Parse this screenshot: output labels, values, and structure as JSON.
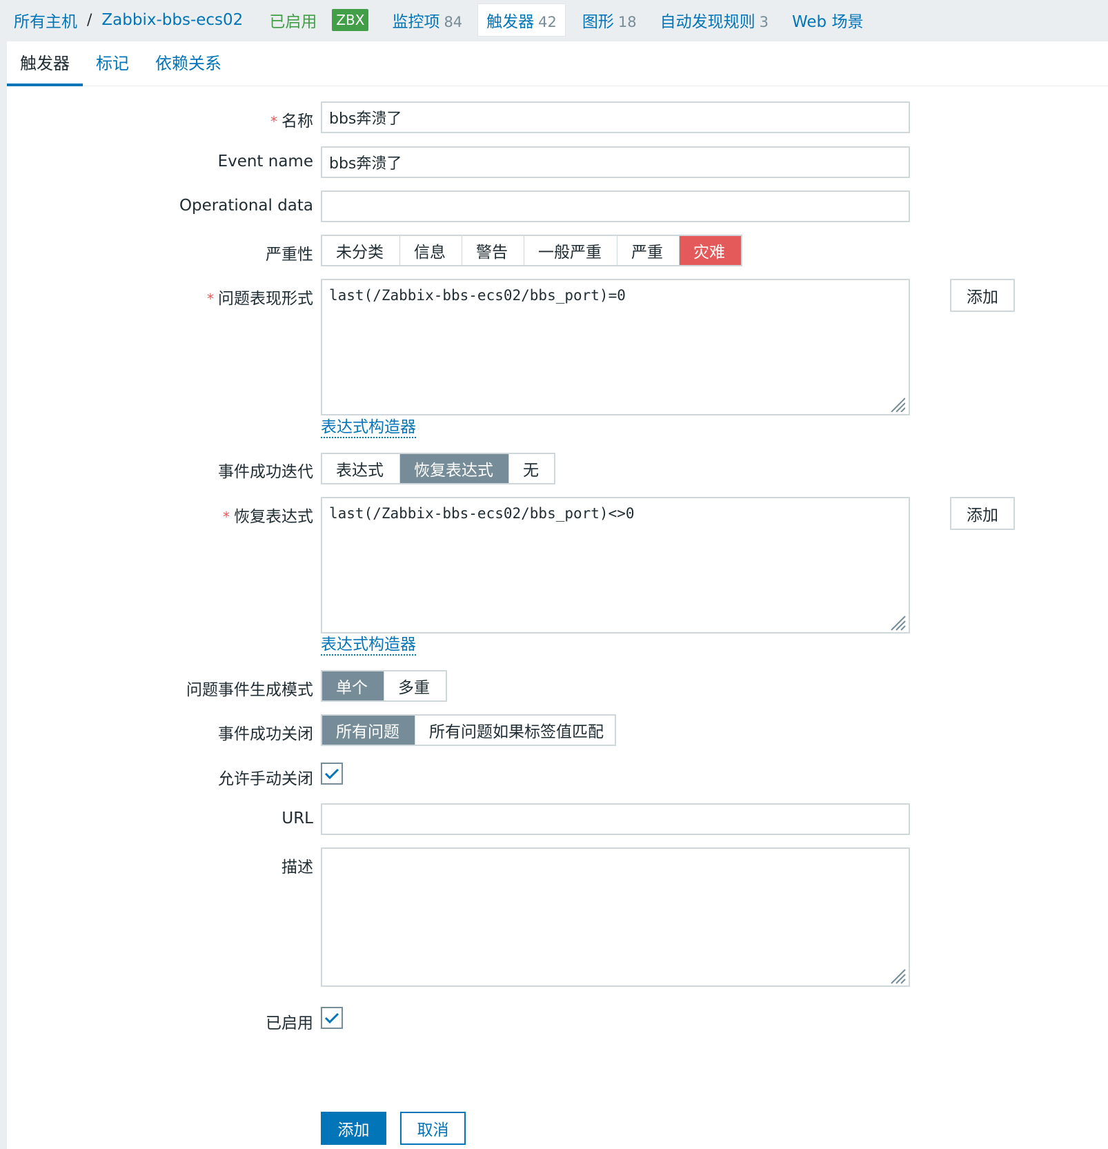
{
  "breadcrumb": {
    "all_hosts": "所有主机",
    "separator": "/",
    "host": "Zabbix-bbs-ecs02",
    "status": "已启用",
    "badge": "ZBX"
  },
  "hostnav": [
    {
      "label": "监控项",
      "count": "84"
    },
    {
      "label": "触发器",
      "count": "42"
    },
    {
      "label": "图形",
      "count": "18"
    },
    {
      "label": "自动发现规则",
      "count": "3"
    },
    {
      "label": "Web 场景",
      "count": ""
    }
  ],
  "tabs": [
    "触发器",
    "标记",
    "依赖关系"
  ],
  "form": {
    "name_label": "名称",
    "name_value": "bbs奔溃了",
    "event_name_label": "Event name",
    "event_name_value": "bbs奔溃了",
    "opdata_label": "Operational data",
    "opdata_value": "",
    "severity_label": "严重性",
    "severity_options": [
      "未分类",
      "信息",
      "警告",
      "一般严重",
      "严重",
      "灾难"
    ],
    "severity_selected": "灾难",
    "problem_label": "问题表现形式",
    "problem_value": "last(/Zabbix-bbs-ecs02/bbs_port)=0",
    "add_label": "添加",
    "builder_label": "表达式构造器",
    "ok_event_label": "事件成功迭代",
    "ok_event_options": [
      "表达式",
      "恢复表达式",
      "无"
    ],
    "ok_event_selected": "恢复表达式",
    "recovery_label": "恢复表达式",
    "recovery_value": "last(/Zabbix-bbs-ecs02/bbs_port)<>0",
    "gen_mode_label": "问题事件生成模式",
    "gen_mode_options": [
      "单个",
      "多重"
    ],
    "gen_mode_selected": "单个",
    "ok_close_label": "事件成功关闭",
    "ok_close_options": [
      "所有问题",
      "所有问题如果标签值匹配"
    ],
    "ok_close_selected": "所有问题",
    "manual_close_label": "允许手动关闭",
    "manual_close_checked": true,
    "url_label": "URL",
    "url_value": "",
    "desc_label": "描述",
    "desc_value": "",
    "enabled_label": "已启用",
    "enabled_checked": true,
    "submit_label": "添加",
    "cancel_label": "取消"
  },
  "colors": {
    "link": "#0275b8",
    "enabled": "#429e47",
    "disaster": "#e45959",
    "selected_grey": "#768d99"
  }
}
